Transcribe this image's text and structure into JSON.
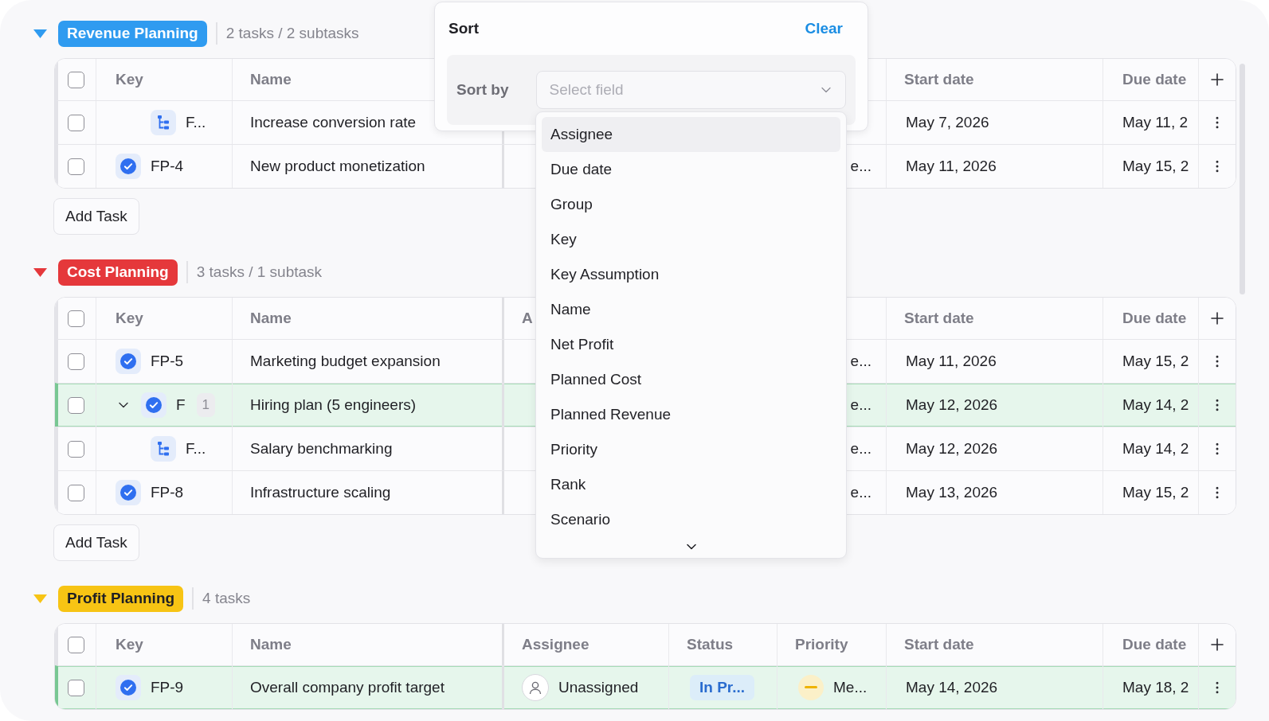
{
  "groups": [
    {
      "name": "Revenue Planning",
      "color": "#2f9bf0",
      "expanded": true,
      "summary": "2 tasks / 2 subtasks",
      "select_all_checked": false,
      "columns": {
        "key": "Key",
        "name": "Name",
        "start": "Start date",
        "due": "Due date"
      },
      "rows": [
        {
          "kind": "subtask",
          "checked": false,
          "highlighted": false,
          "key": "F...",
          "name": "Increase conversion rate",
          "start": "May 7, 2026",
          "due": "May 11, 2"
        },
        {
          "kind": "task",
          "checked": false,
          "highlighted": false,
          "key": "FP-4",
          "name": "New product monetization",
          "priority": {
            "kind": "covered",
            "label": "e..."
          },
          "start": "May 11, 2026",
          "due": "May 15, 2"
        }
      ],
      "add_task": "Add Task"
    },
    {
      "name": "Cost Planning",
      "color": "#e5383b",
      "expanded": true,
      "summary": "3 tasks / 1 subtask",
      "select_all_checked": false,
      "columns": {
        "key": "Key",
        "name": "Name",
        "assignee": "A",
        "start": "Start date",
        "due": "Due date"
      },
      "rows": [
        {
          "kind": "task",
          "checked": false,
          "highlighted": false,
          "key": "FP-5",
          "name": "Marketing budget expansion",
          "priority": {
            "kind": "covered",
            "label": "e..."
          },
          "start": "May 11, 2026",
          "due": "May 15, 2"
        },
        {
          "kind": "parent",
          "checked": false,
          "highlighted": true,
          "expanded": true,
          "key": "F",
          "subtask_count": "1",
          "name": "Hiring plan (5 engineers)",
          "priority": {
            "kind": "covered",
            "label": "e..."
          },
          "start": "May 12, 2026",
          "due": "May 14, 2"
        },
        {
          "kind": "subtask",
          "checked": false,
          "highlighted": false,
          "key": "F...",
          "name": "Salary benchmarking",
          "priority": {
            "kind": "covered",
            "label": "e..."
          },
          "start": "May 12, 2026",
          "due": "May 14, 2"
        },
        {
          "kind": "task",
          "checked": false,
          "highlighted": false,
          "key": "FP-8",
          "name": "Infrastructure scaling",
          "priority": {
            "kind": "covered",
            "label": "e..."
          },
          "start": "May 13, 2026",
          "due": "May 15, 2"
        }
      ],
      "add_task": "Add Task"
    },
    {
      "name": "Profit Planning",
      "color": "#f7c414",
      "expanded": true,
      "summary": "4 tasks",
      "select_all_checked": false,
      "columns": {
        "key": "Key",
        "name": "Name",
        "assignee": "Assignee",
        "status": "Status",
        "priority": "Priority",
        "start": "Start date",
        "due": "Due date"
      },
      "rows": [
        {
          "kind": "task",
          "checked": false,
          "highlighted": true,
          "key": "FP-9",
          "name": "Overall company profit target",
          "assignee": "Unassigned",
          "status": "In Pr...",
          "priority": {
            "kind": "medium",
            "label": "Me..."
          },
          "start": "May 14, 2026",
          "due": "May 18, 2"
        }
      ]
    }
  ],
  "sort": {
    "title": "Sort",
    "clear": "Clear",
    "label": "Sort by",
    "field": {
      "placeholder": "Select field"
    },
    "options": [
      {
        "label": "Assignee",
        "selected": true
      },
      {
        "label": "Due date",
        "selected": false
      },
      {
        "label": "Group",
        "selected": false
      },
      {
        "label": "Key",
        "selected": false
      },
      {
        "label": "Key Assumption",
        "selected": false
      },
      {
        "label": "Name",
        "selected": false
      },
      {
        "label": "Net Profit",
        "selected": false
      },
      {
        "label": "Planned Cost",
        "selected": false
      },
      {
        "label": "Planned Revenue",
        "selected": false
      },
      {
        "label": "Priority",
        "selected": false
      },
      {
        "label": "Rank",
        "selected": false
      },
      {
        "label": "Scenario",
        "selected": false
      }
    ]
  }
}
